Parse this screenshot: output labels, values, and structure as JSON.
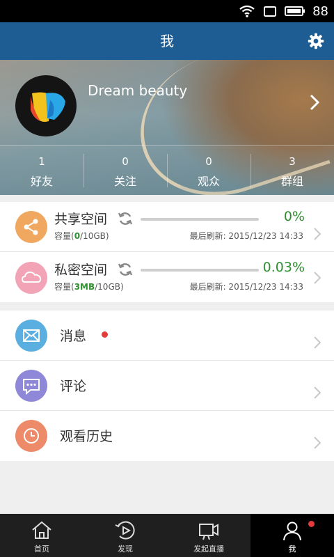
{
  "status_bar": {
    "battery_text": "88"
  },
  "header": {
    "title": "我"
  },
  "profile": {
    "name": "Dream beauty",
    "stats": [
      {
        "count": "1",
        "label": "好友"
      },
      {
        "count": "0",
        "label": "关注"
      },
      {
        "count": "0",
        "label": "观众"
      },
      {
        "count": "3",
        "label": "群组"
      }
    ]
  },
  "storage": [
    {
      "name": "共享空间",
      "percent": "0%",
      "usage_fraction": 0.0,
      "capacity_prefix": "容量(",
      "used": "0",
      "total": "/10GB)",
      "refreshed": "最后刷新: 2015/12/23 14:33",
      "color": "#f0a860"
    },
    {
      "name": "私密空间",
      "percent": "0.03%",
      "usage_fraction": 0.0003,
      "capacity_prefix": "容量(",
      "used": "3MB",
      "total": "/10GB)",
      "refreshed": "最后刷新: 2015/12/23 14:33",
      "color": "#f2a3b6"
    }
  ],
  "menu": [
    {
      "label": "消息",
      "icon": "envelope-icon",
      "color": "#5aaee0",
      "badge": true
    },
    {
      "label": "评论",
      "icon": "comment-icon",
      "color": "#8f88d8",
      "badge": false
    },
    {
      "label": "观看历史",
      "icon": "clock-icon",
      "color": "#ec8a6a",
      "badge": false
    }
  ],
  "bottom_nav": [
    {
      "label": "首页",
      "icon": "home-icon",
      "active": false
    },
    {
      "label": "发现",
      "icon": "discover-play-icon",
      "active": false
    },
    {
      "label": "发起直播",
      "icon": "video-camera-icon",
      "active": false
    },
    {
      "label": "我",
      "icon": "user-icon",
      "active": true,
      "badge": true
    }
  ],
  "colors": {
    "header_bg": "#1d5d93",
    "progress_fill": "#3a9d3a",
    "badge_red": "#e23b3b"
  }
}
